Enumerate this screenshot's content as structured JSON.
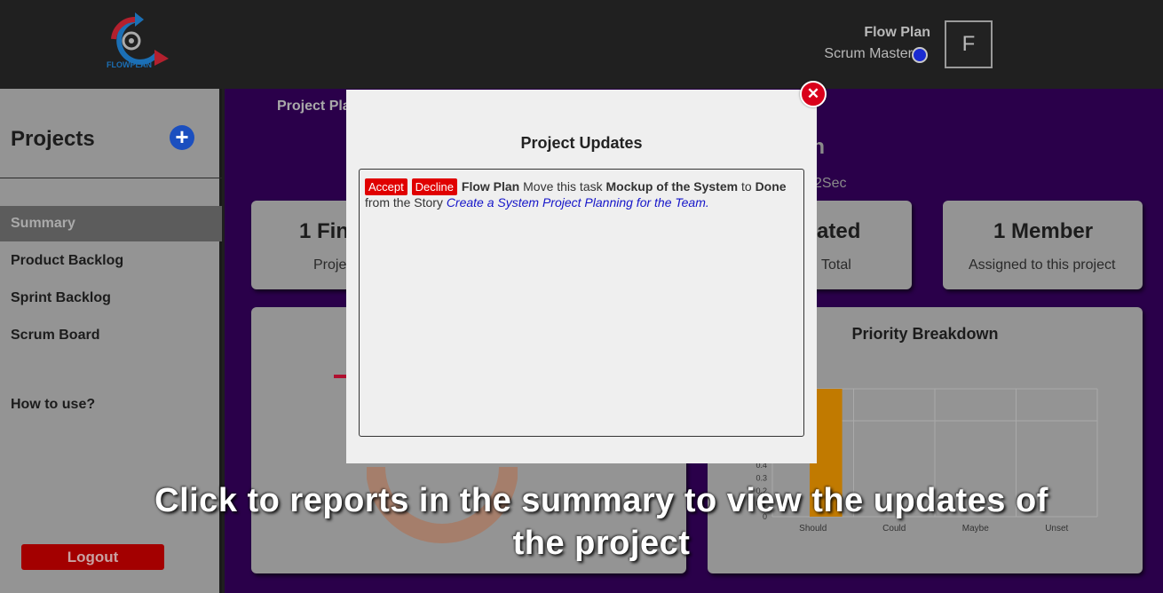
{
  "header": {
    "logo_text": "FLOWPLAN",
    "user_name": "Flow Plan",
    "user_role": "Scrum Master",
    "avatar_letter": "F"
  },
  "sidebar": {
    "title": "Projects",
    "items": [
      {
        "label": "Summary"
      },
      {
        "label": "Product Backlog"
      },
      {
        "label": "Sprint Backlog"
      },
      {
        "label": "Scrum Board"
      },
      {
        "label": "How to use?"
      }
    ],
    "logout_label": "Logout"
  },
  "main": {
    "breadcrumb": "Project Pla",
    "title_fragment": "an",
    "time_fragment": "2Sec",
    "cards": [
      {
        "big": "1 Fin",
        "sub": "Proje"
      },
      {
        "big": "ated",
        "sub": "Total"
      },
      {
        "big": "1 Member",
        "sub": "Assigned to this project"
      }
    ],
    "priority_title": "Priority Breakdown"
  },
  "modal": {
    "title": "Project Updates",
    "accept_label": "Accept",
    "decline_label": "Decline",
    "user": "Flow Plan",
    "text1": "Move this task",
    "task": "Mockup of the System",
    "text2": "to",
    "status": "Done",
    "text3": "from the Story",
    "story": "Create a System Project Planning for the Team",
    "period": ".",
    "close_symbol": "✕"
  },
  "caption": "Click to reports in the summary to view the updates of the project",
  "chart_data": {
    "type": "bar",
    "title": "Priority Breakdown",
    "categories": [
      "Should",
      "Could",
      "Maybe",
      "Unset"
    ],
    "values": [
      1,
      0,
      0,
      0
    ],
    "y_ticks": [
      "0",
      "0.1",
      "0.2",
      "0.3",
      "0.4"
    ],
    "bar_color": "#c17a00"
  }
}
